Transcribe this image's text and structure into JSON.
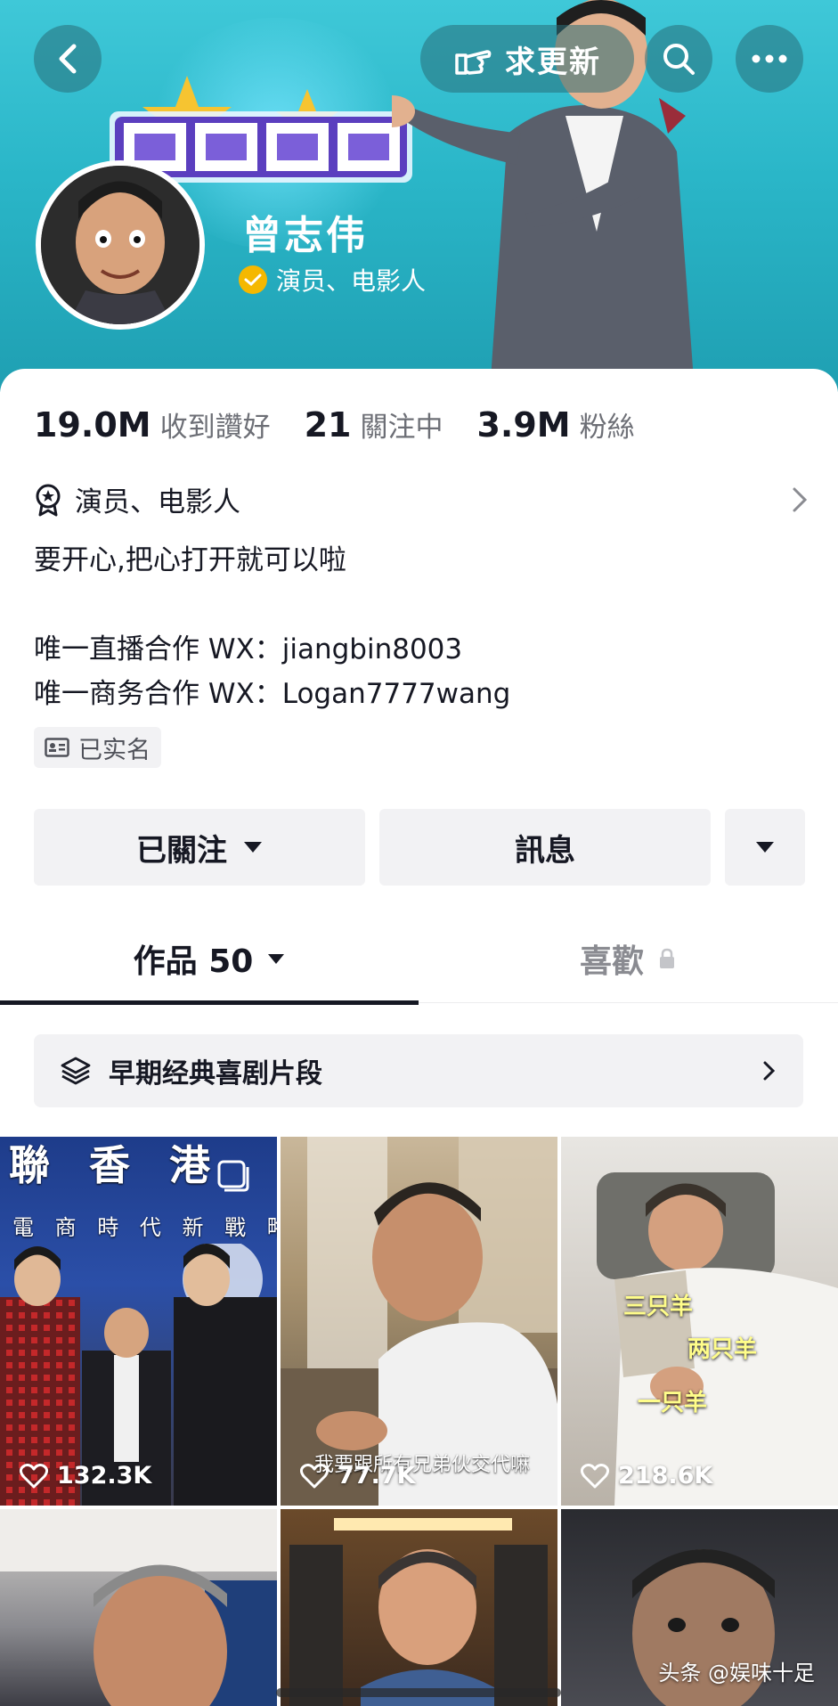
{
  "header": {
    "update_label": "求更新",
    "name": "曾志伟",
    "verify_text": "演员、电影人"
  },
  "stats": [
    {
      "value": "19.0M",
      "label": "收到讚好"
    },
    {
      "value": "21",
      "label": "關注中"
    },
    {
      "value": "3.9M",
      "label": "粉絲"
    }
  ],
  "profile": {
    "role": "演员、电影人",
    "bio": [
      "要开心,把心打开就可以啦",
      "",
      "唯一直播合作 WX：jiangbin8003",
      "唯一商务合作 WX：Logan7777wang"
    ],
    "realname_label": "已实名"
  },
  "actions": {
    "follow_label": "已關注",
    "message_label": "訊息"
  },
  "tabs": {
    "works_label": "作品 50",
    "likes_label": "喜歡"
  },
  "playlist": {
    "label": "早期经典喜剧片段"
  },
  "videos": [
    {
      "likes": "132.3K",
      "overlay_top": "聯 香 港",
      "overlay_sub": "電 商 時 代 新 戰 略"
    },
    {
      "likes": "77.7K",
      "caption": "我要跟所有兄弟伙交代嘛"
    },
    {
      "likes": "218.6K",
      "sheep": [
        "三只羊",
        "两只羊",
        "一只羊"
      ]
    },
    {
      "likes": ""
    },
    {
      "likes": ""
    },
    {
      "likes": ""
    }
  ],
  "watermark": "头条 @娱味十足",
  "colors": {
    "banner": "#2ab6c8",
    "verify_badge": "#f5b800",
    "button_bg": "#f2f2f4"
  }
}
